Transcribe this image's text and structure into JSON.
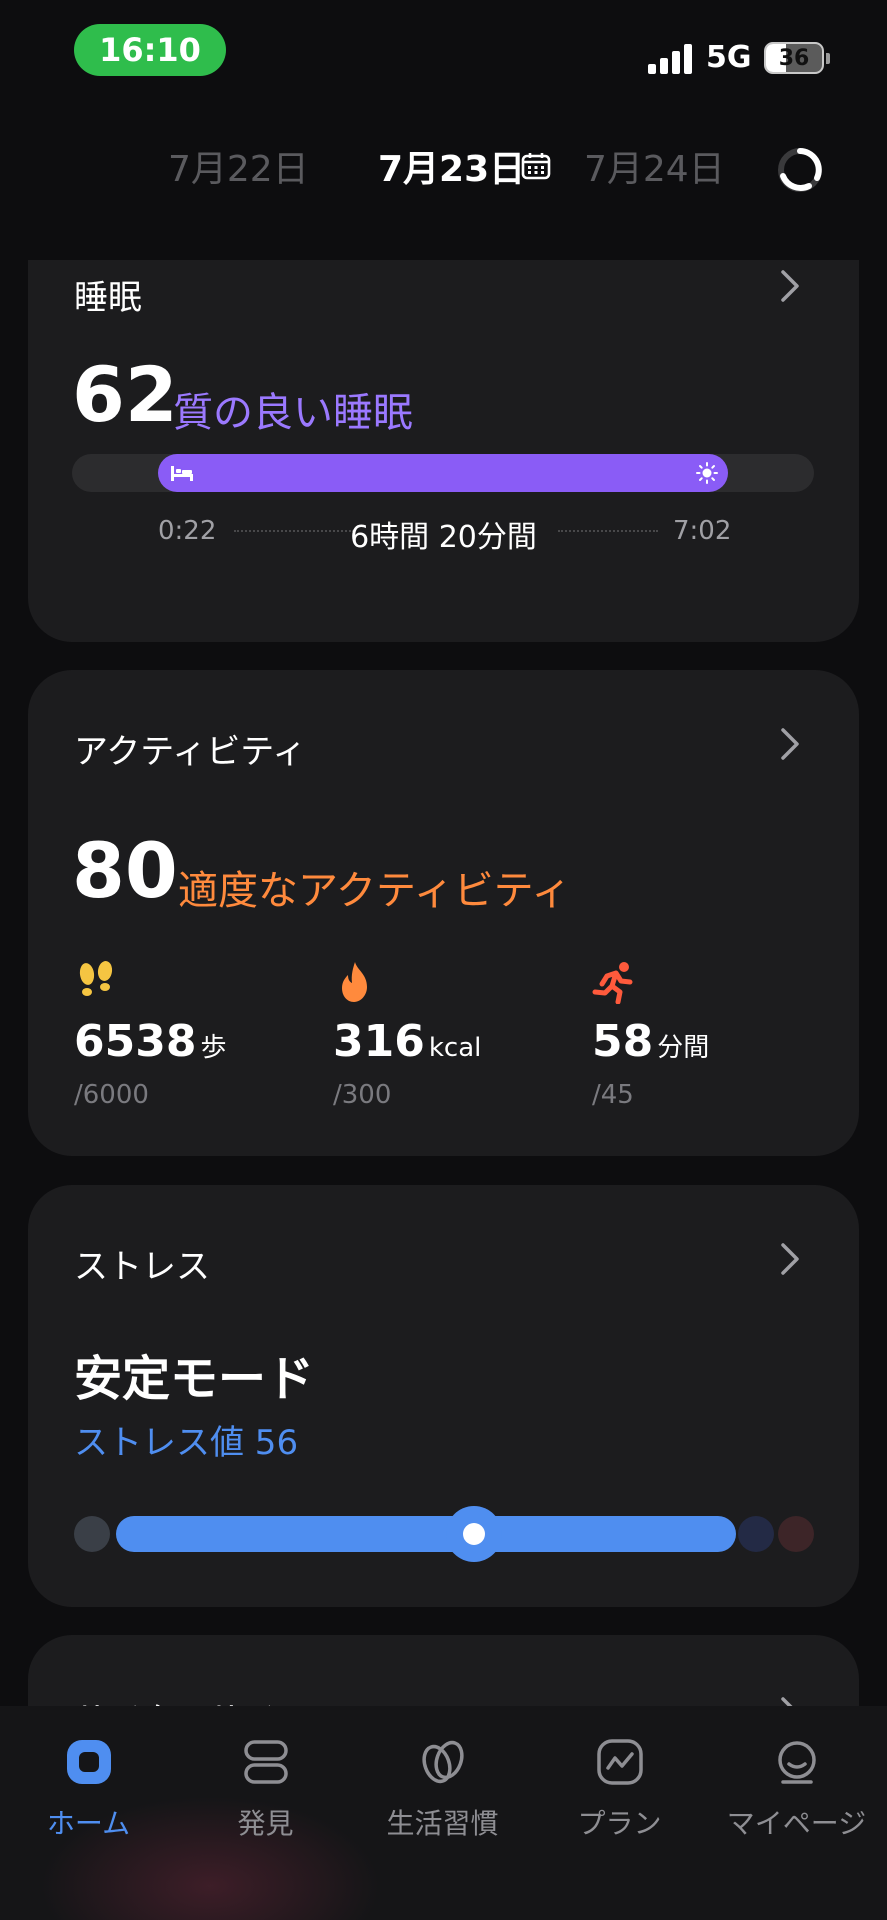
{
  "status_bar": {
    "time": "16:10",
    "network": "5G",
    "battery": "36",
    "battery_level": 0.36
  },
  "date_bar": {
    "prev": "7月22日",
    "current": "7月23日",
    "next": "7月24日"
  },
  "sleep": {
    "title": "睡眠",
    "score": "62",
    "quality": "質の良い睡眠",
    "start": "0:22",
    "end": "7:02",
    "duration": "6時間 20分間"
  },
  "activity": {
    "title": "アクティビティ",
    "score": "80",
    "level": "適度なアクティビティ",
    "metrics": [
      {
        "icon": "footsteps-icon",
        "value": "6538",
        "unit": "歩",
        "target": "/6000",
        "color": "#f5c542"
      },
      {
        "icon": "flame-icon",
        "value": "316",
        "unit": "kcal",
        "target": "/300",
        "color": "#ff8a3d"
      },
      {
        "icon": "running-icon",
        "value": "58",
        "unit": "分間",
        "target": "/45",
        "color": "#ff5a3c"
      }
    ]
  },
  "stress": {
    "title": "ストレス",
    "mode": "安定モード",
    "value_label": "ストレス値 56",
    "level": 56
  },
  "cycle": {
    "title": "サイクルサイン"
  },
  "nav": {
    "items": [
      {
        "label": "ホーム",
        "icon": "home-icon",
        "active": true
      },
      {
        "label": "発見",
        "icon": "discover-icon",
        "active": false
      },
      {
        "label": "生活習慣",
        "icon": "lifestyle-icon",
        "active": false
      },
      {
        "label": "プラン",
        "icon": "plan-icon",
        "active": false
      },
      {
        "label": "マイページ",
        "icon": "profile-icon",
        "active": false
      }
    ]
  },
  "colors": {
    "accent": "#4f8ef0",
    "sleep": "#8a5cf6",
    "activity": "#ff8a3d",
    "card": "#1c1c1e",
    "background": "#0d0d0f"
  }
}
